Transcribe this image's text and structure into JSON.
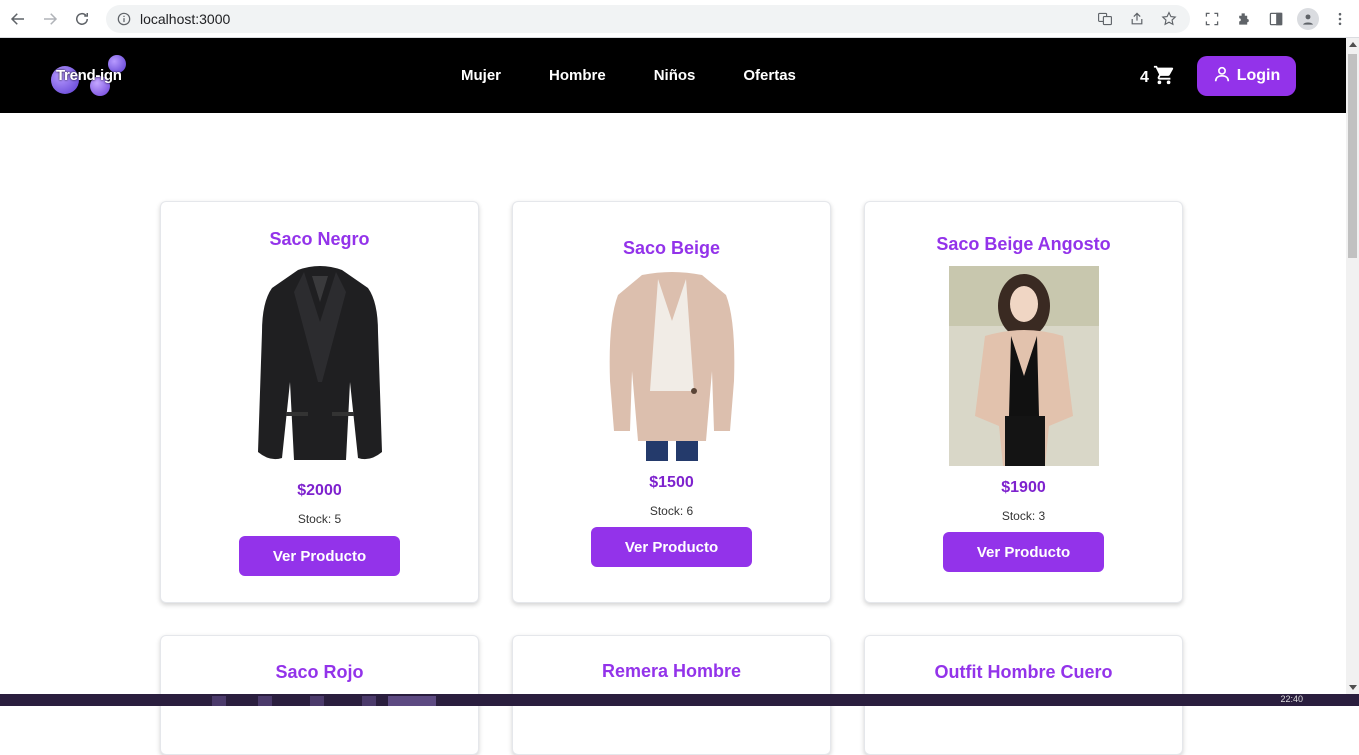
{
  "browser": {
    "url": "localhost:3000",
    "icons": [
      "back-arrow-icon",
      "forward-arrow-icon",
      "reload-icon",
      "info-icon",
      "translate-icon",
      "share-icon",
      "star-icon",
      "screenshot-icon",
      "extensions-icon",
      "sidepanel-icon",
      "profile-icon",
      "kebab-menu-icon"
    ]
  },
  "header": {
    "logo_text": "Trend-ign",
    "nav": [
      "Mujer",
      "Hombre",
      "Niños",
      "Ofertas"
    ],
    "cart_count": "4",
    "login_label": "Login"
  },
  "products": [
    {
      "title": "Saco Negro",
      "price": "$2000",
      "stock": "Stock: 5",
      "button": "Ver Producto",
      "image": "black-blazer"
    },
    {
      "title": "Saco Beige",
      "price": "$1500",
      "stock": "Stock: 6",
      "button": "Ver Producto",
      "image": "beige-blazer"
    },
    {
      "title": "Saco Beige Angosto",
      "price": "$1900",
      "stock": "Stock: 3",
      "button": "Ver Producto",
      "image": "beige-fitted-blazer"
    },
    {
      "title": "Saco Rojo"
    },
    {
      "title": "Remera Hombre"
    },
    {
      "title": "Outfit Hombre Cuero"
    }
  ],
  "taskbar": {
    "clock": "22:40"
  },
  "colors": {
    "accent": "#9333ea",
    "header_bg": "#000000",
    "price": "#7e22ce"
  }
}
